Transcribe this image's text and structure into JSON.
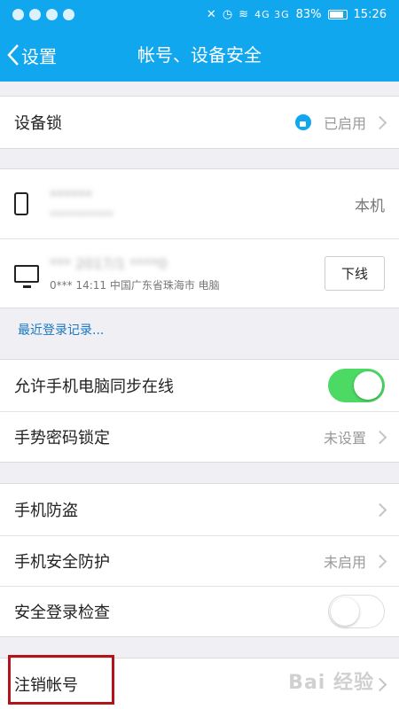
{
  "status_bar": {
    "signal_labels": "4G 3G",
    "battery": "83%",
    "time": "15:26"
  },
  "nav": {
    "back_label": "设置",
    "title": "帐号、设备安全"
  },
  "device_lock": {
    "label": "设备锁",
    "status": "已启用"
  },
  "devices": [
    {
      "type": "phone",
      "name": "******",
      "info": "************",
      "badge": "本机"
    },
    {
      "type": "pc",
      "name": "*** 2017/1 ****0",
      "info": "0*** 14:11 中国广东省珠海市 电脑",
      "action_label": "下线"
    }
  ],
  "recent_login_link": "最近登录记录...",
  "sync_group": {
    "allow_sync": {
      "label": "允许手机电脑同步在线",
      "enabled": true
    },
    "gesture_lock": {
      "label": "手势密码锁定",
      "status": "未设置"
    }
  },
  "security_group": {
    "anti_theft": {
      "label": "手机防盗"
    },
    "phone_protection": {
      "label": "手机安全防护",
      "status": "未启用"
    },
    "login_check": {
      "label": "安全登录检查",
      "enabled": false
    }
  },
  "deactivate": {
    "label": "注销帐号"
  },
  "watermark": "Bai 经验",
  "colors": {
    "primary": "#11a7ef",
    "toggle_on": "#4cd964",
    "link": "#1a78c2",
    "highlight": "#b3141c"
  }
}
